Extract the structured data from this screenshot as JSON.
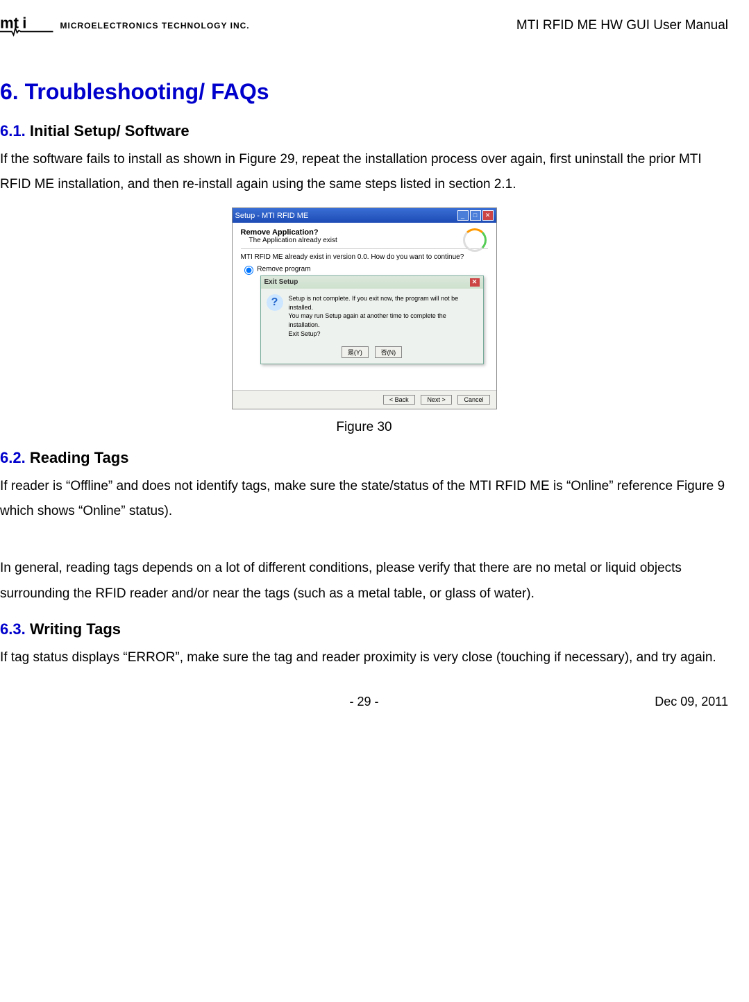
{
  "header": {
    "logo_company": "MICROELECTRONICS TECHNOLOGY INC.",
    "doc_title": "MTI RFID ME HW GUI User Manual"
  },
  "h1": "6. Troubleshooting/ FAQs",
  "s61": {
    "num": "6.1.",
    "title": "Initial Setup/ Software",
    "p1": "If the software fails to install as shown in Figure 29, repeat the installation process over again, first uninstall the prior MTI RFID ME installation, and then re-install again using the same steps listed in section 2.1."
  },
  "figure": {
    "caption": "Figure 30",
    "win_title": "Setup - MTI RFID ME",
    "remove_q": "Remove Application?",
    "remove_sub": "The Application already exist",
    "exist_msg": "MTI RFID ME already exist in version 0.0. How do you want to continue?",
    "radio_label": "Remove program",
    "dlg_title": "Exit Setup",
    "dlg_l1": "Setup is not complete. If you exit now, the program will not be installed.",
    "dlg_l2": "You may run Setup again at another time to complete the installation.",
    "dlg_l3": "Exit Setup?",
    "btn_yes": "是(Y)",
    "btn_no": "否(N)",
    "btn_back": "< Back",
    "btn_next": "Next >",
    "btn_cancel": "Cancel"
  },
  "s62": {
    "num": "6.2.",
    "title": "Reading Tags",
    "p1": "If reader is “Offline” and does not identify tags, make sure the state/status of the MTI RFID ME is “Online” reference Figure 9 which shows “Online” status).",
    "p2": "In general, reading tags depends on a lot of different conditions, please verify that there are no metal or liquid objects surrounding the RFID reader and/or near the tags (such as a metal table, or glass of water)."
  },
  "s63": {
    "num": "6.3.",
    "title": "Writing Tags",
    "p1": "If tag status displays “ERROR”, make sure the tag and reader proximity is very close (touching if necessary), and try again."
  },
  "footer": {
    "page": "- 29 -",
    "date": "Dec 09, 2011"
  }
}
